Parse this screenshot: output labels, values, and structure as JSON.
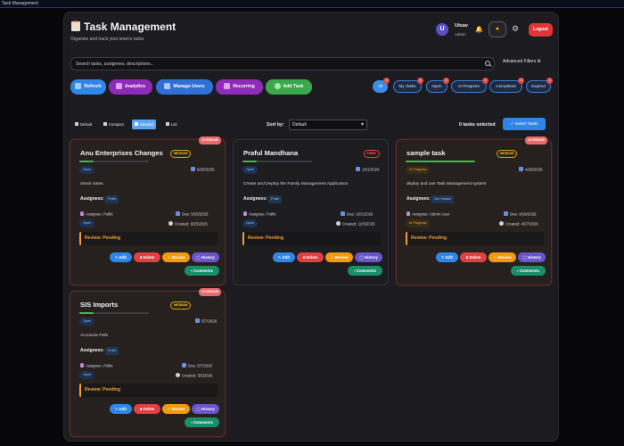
{
  "window": {
    "title": "Task Management"
  },
  "header": {
    "title": "Task Management",
    "subtitle": "Organize and track your team's tasks",
    "avatar_initial": "U",
    "user_name": "Utsav",
    "user_role": "Admin",
    "logout_label": "Logout"
  },
  "search": {
    "placeholder": "Search tasks, assignees, descriptions...",
    "value": "",
    "advanced_filters_label": "Advanced Filters"
  },
  "actions": {
    "refresh": "Refresh",
    "analytics": "Analytics",
    "manage_users": "Manage Users",
    "recurring": "Recurring",
    "add_task": "Add Task"
  },
  "filters": [
    {
      "label": "All",
      "count": "4"
    },
    {
      "label": "My Tasks",
      "count": "0"
    },
    {
      "label": "Open",
      "count": "3"
    },
    {
      "label": "In Progress",
      "count": "1"
    },
    {
      "label": "Completed",
      "count": "0"
    },
    {
      "label": "Expired",
      "count": "4"
    }
  ],
  "views": {
    "default": "Default",
    "compact": "Compact",
    "detailed": "Detailed",
    "list": "List",
    "active": "Detailed"
  },
  "sort": {
    "label": "Sort by:",
    "value": "Default"
  },
  "selection": {
    "count_text": "0 tasks selected",
    "select_button": "Select Tasks"
  },
  "labels": {
    "assignees": "Assignees:",
    "assignee_prefix": "Assignee:",
    "due_prefix": "Due:",
    "created_prefix": "Created:",
    "review": "Review: Pending",
    "edit": "Edit",
    "delete": "Delete",
    "review_btn": "Review",
    "history": "History",
    "comments": "Comments"
  },
  "tasks": [
    {
      "title": "Anu Enterprises Changes",
      "priority": "MEDIUM",
      "overdue": "OVERDUE",
      "progress": 0.2,
      "status": "Open",
      "date": "9/25/2025",
      "description": "check notes",
      "assignee_tag": "Pulkit",
      "assignee": "Pulkit",
      "due": "9/25/2025",
      "status2": "Open",
      "created": "9/25/2025"
    },
    {
      "title": "Praful Mandhana",
      "priority": "HIGH",
      "overdue": "",
      "progress": 0.2,
      "status": "Open",
      "date": "10/1/2026",
      "description": "Create and Deploy the Family Management Application",
      "assignee_tag": "Pulkit",
      "assignee": "Pulkit",
      "due": "10/1/2026",
      "status2": "Open",
      "created": "11/5/2025"
    },
    {
      "title": "sample task",
      "priority": "MEDIUM",
      "overdue": "OVERDUE",
      "progress": 1.0,
      "status": "In Progress",
      "date": "4/29/2026",
      "description": "deploy and use Task Management system",
      "assignee_tag": "Om Holash",
      "assignee": "Admin User",
      "due": "4/29/2026",
      "status2": "In Progress",
      "created": "4/27/2026"
    },
    {
      "title": "SIS Imports",
      "priority": "MEDIUM",
      "overdue": "OVERDUE",
      "progress": 0.2,
      "status": "Open",
      "date": "5/7/2026",
      "description": "Accounts FMS",
      "assignee_tag": "Pulkit",
      "assignee": "Pulkit",
      "due": "5/7/2026",
      "status2": "Open",
      "created": "5/5/2026"
    }
  ],
  "colors": {
    "accent": "#2f86e6",
    "danger": "#e03535",
    "warning": "#f09a10",
    "success": "#3fb950",
    "history": "#6a55c8",
    "comments": "#17906a"
  }
}
